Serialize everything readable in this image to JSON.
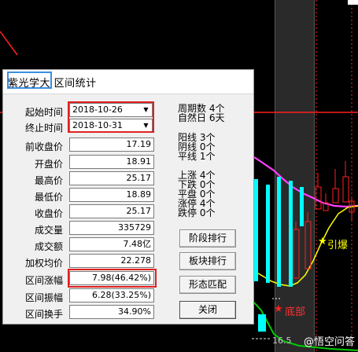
{
  "dialog": {
    "title": "紫光学大 区间统计",
    "start_time_label": "起始时间",
    "start_time_value": "2018-10-26",
    "end_time_label": "终止时间",
    "end_time_value": "2018-10-31",
    "dropdown_glyph": "▼",
    "fields": [
      {
        "label": "前收盘价",
        "value": "17.19"
      },
      {
        "label": "开盘价",
        "value": "18.91"
      },
      {
        "label": "最高价",
        "value": "25.17"
      },
      {
        "label": "最低价",
        "value": "18.89"
      },
      {
        "label": "收盘价",
        "value": "25.17"
      },
      {
        "label": "成交量",
        "value": "335729"
      },
      {
        "label": "成交额",
        "value": "7.48亿"
      },
      {
        "label": "加权均价",
        "value": "22.278"
      },
      {
        "label": "区间涨幅",
        "value": "7.98(46.42%)"
      },
      {
        "label": "区间振幅",
        "value": "6.28(33.25%)"
      },
      {
        "label": "区间换手",
        "value": "34.90%"
      }
    ],
    "period_stats": {
      "zhouqishu": "周期数 4个",
      "ziranri": "自然日 6天"
    },
    "candle_stats": {
      "yangxian": "阳线 3个",
      "yinxian": "阴线 0个",
      "pingxian": "平线 1个"
    },
    "move_stats": {
      "shangzhang": "上涨 4个",
      "xiadie": "下跌 0个",
      "pingpan": "平盘 0个",
      "zhangting": "涨停 4个",
      "dieting": "跌停 0个"
    },
    "buttons": {
      "stage_rank": "阶段排行",
      "sector_rank": "板块排行",
      "pattern_match": "形态匹配",
      "close": "关闭"
    }
  },
  "chart": {
    "label_yinbao": "引爆",
    "label_dibu": "底部",
    "star_glyph": "★",
    "price_label": "16.5",
    "watermark": "@悟空问答"
  },
  "colors": {
    "chart_bg": "#000000",
    "up_candle": "#ff2020",
    "limit_up_candle": "#00ffff",
    "ma_magenta": "#ff40ff",
    "ma_yellow": "#ffff00",
    "ma_green": "#00cc00",
    "red_highlight": "#e02020",
    "title_highlight": "#3a8fe0"
  }
}
